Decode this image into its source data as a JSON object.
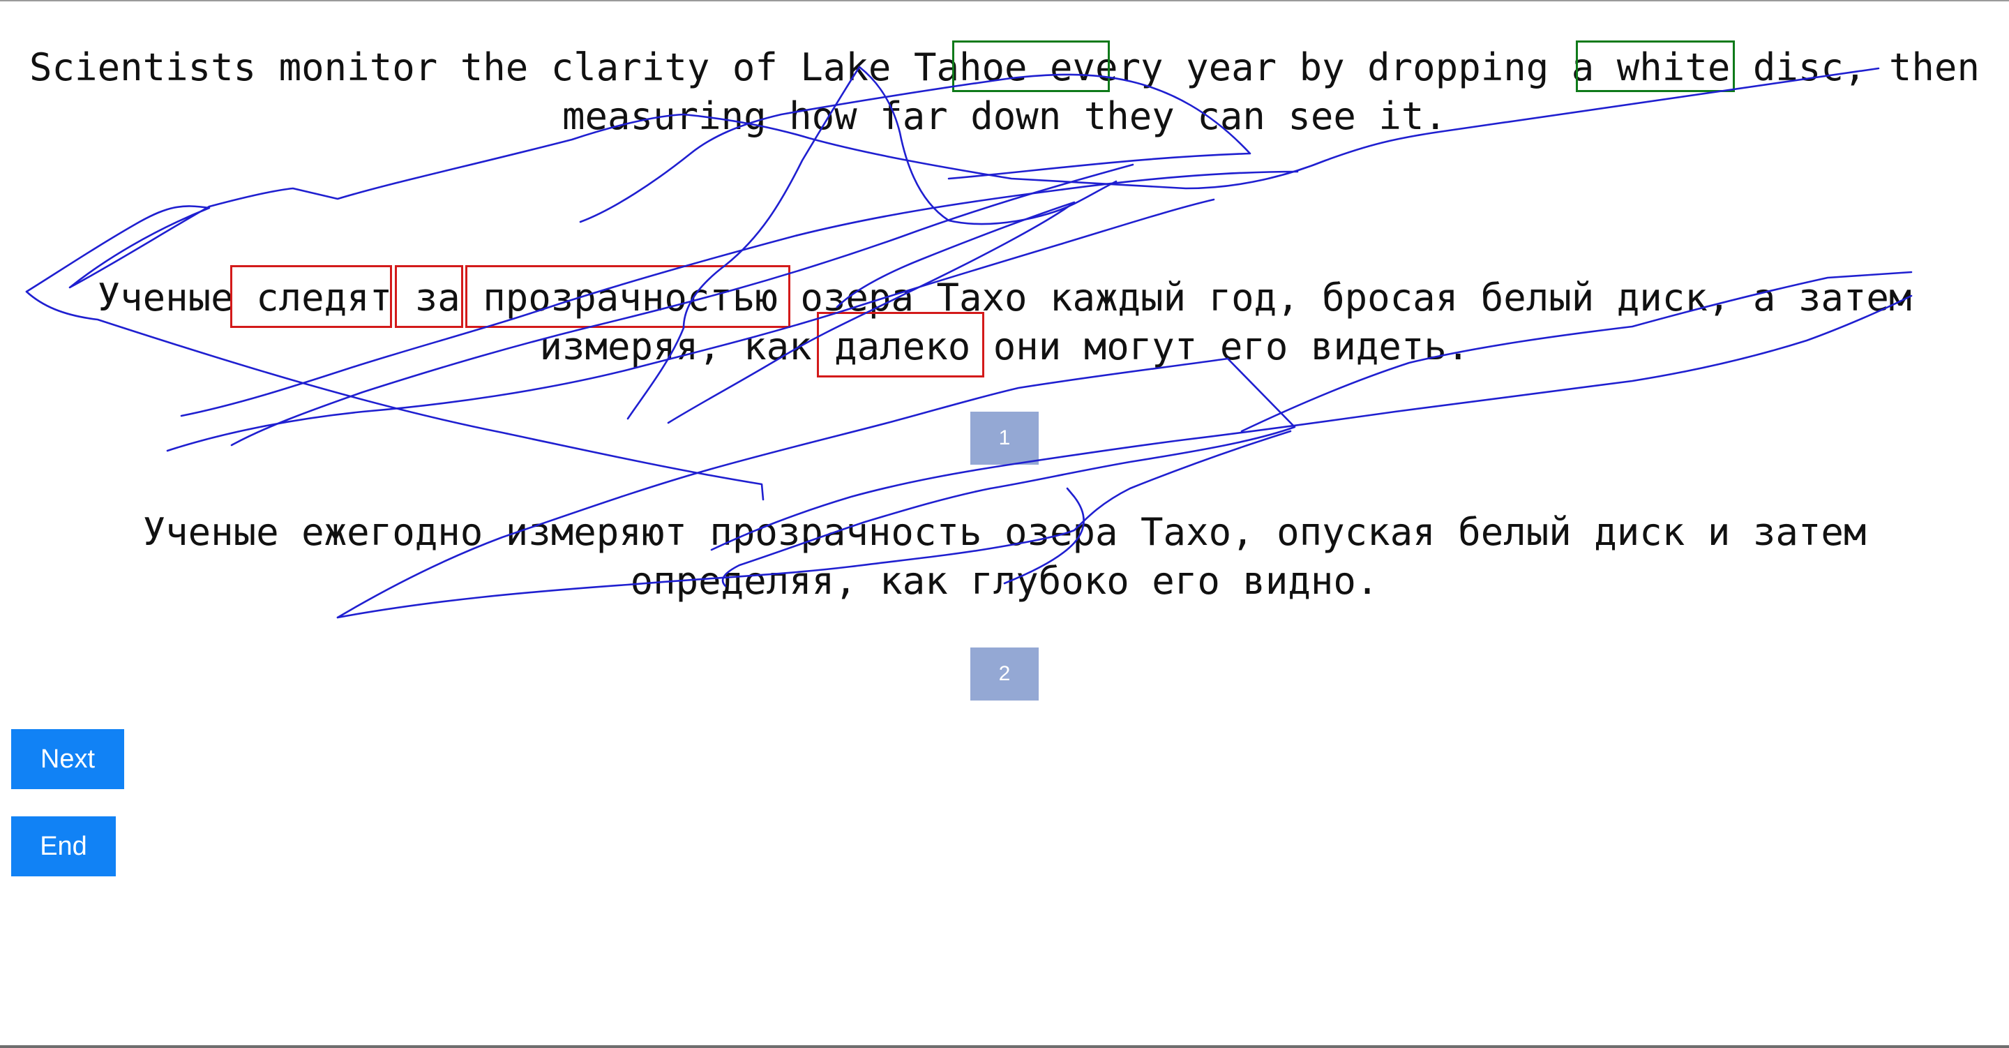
{
  "source_sentence": {
    "line1": "Scientists monitor the clarity of Lake Tahoe every year by dropping a white disc, then",
    "line2": "measuring how far down they can see it."
  },
  "translation_sentence": {
    "line1": "Ученые следят за прозрачностью озера Тахо каждый год, бросая белый диск, а затем",
    "line2": "измеряя, как далеко они могут его видеть."
  },
  "reference_sentence": {
    "line1": "Ученые ежегодно измеряют прозрачность озера Тахо, опуская белый диск и затем",
    "line2": "определяя, как глубоко его видно."
  },
  "highlights": {
    "source": [
      "hoe every",
      "a white"
    ],
    "translation": [
      "следят",
      "за",
      "прозрачностью",
      "далеко"
    ],
    "colors": {
      "source": "#0f7a1a",
      "translation": "#d31a1a"
    }
  },
  "buttons": {
    "option1": "1",
    "option2": "2",
    "next": "Next",
    "end": "End"
  },
  "colors": {
    "option_button": "#94a8d4",
    "action_button": "#1182f5",
    "scribble": "#1f1fd0"
  }
}
